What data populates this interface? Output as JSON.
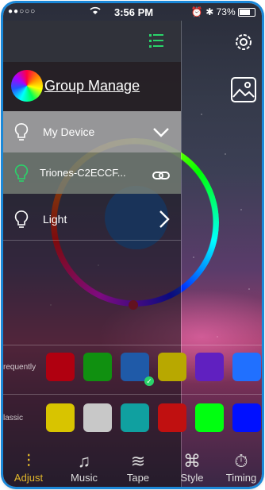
{
  "status_bar": {
    "carrier": "●●○○○",
    "time": "3:56 PM",
    "battery": "73%"
  },
  "drawer": {
    "group_label": "Group Manage",
    "rows": [
      {
        "label": "My Device",
        "right_icon": "chevron-down-icon"
      },
      {
        "label": "Triones-C2ECCF...",
        "right_icon": "link-icon"
      },
      {
        "label": "Light",
        "right_icon": "chevron-right-icon"
      }
    ]
  },
  "swatches": {
    "frequently_caption": "requently",
    "frequently": [
      "#b00010",
      "#109010",
      "#1f5aa8",
      "#b8a800",
      "#6020c0",
      "#2070ff"
    ],
    "classic_caption": "lassic",
    "classic": [
      "#d8c400",
      "#c8c8c8",
      "#10a0a0",
      "#c01010",
      "#00ff10",
      "#0010ff"
    ]
  },
  "tabs": [
    {
      "label": "Adjust",
      "icon": "sliders-icon",
      "active": true
    },
    {
      "label": "Music",
      "icon": "music-note-icon",
      "active": false
    },
    {
      "label": "Tape",
      "icon": "wave-icon",
      "active": false
    },
    {
      "label": "Style",
      "icon": "command-icon",
      "active": false
    },
    {
      "label": "Timing",
      "icon": "timer-icon",
      "active": false
    }
  ],
  "colors": {
    "accent": "#e2b82b",
    "menu_green": "#2ad36a"
  }
}
